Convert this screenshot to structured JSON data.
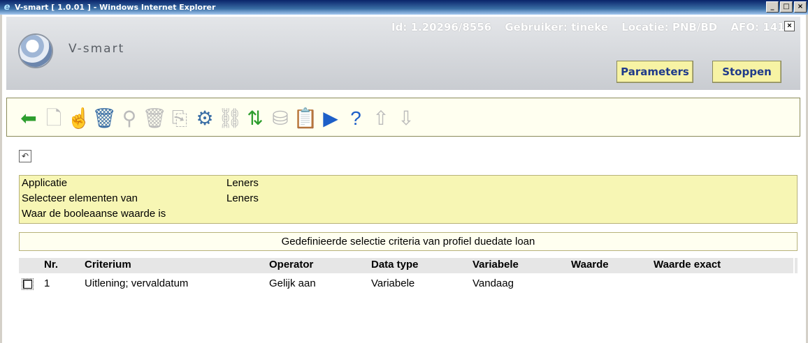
{
  "window": {
    "title": "V-smart [ 1.0.01 ] - Windows Internet Explorer",
    "controls": [
      "_",
      "□",
      "×"
    ]
  },
  "header": {
    "brand": "V-smart",
    "id_label": "Id: 1.20296/8556",
    "user_label": "Gebruiker: tineke",
    "location_label": "Locatie: PNB/BD",
    "afo_label": "AFO: 141",
    "close_glyph": "⊠",
    "parameters_button": "Parameters",
    "stop_button": "Stoppen"
  },
  "toolbar": {
    "icons": [
      {
        "name": "back-arrow-icon",
        "glyph": "⬅",
        "color": "#2e9e2e",
        "enabled": true
      },
      {
        "name": "new-document-icon",
        "glyph": "🗋",
        "color": "#bbbbbb",
        "enabled": false
      },
      {
        "name": "select-hand-icon",
        "glyph": "☝",
        "color": "#555555",
        "enabled": true
      },
      {
        "name": "delete-bin-icon",
        "glyph": "🗑",
        "color": "#3a6ea5",
        "enabled": true
      },
      {
        "name": "search-icon",
        "glyph": "⚲",
        "color": "#bbbbbb",
        "enabled": false
      },
      {
        "name": "delete-bin-disabled-icon",
        "glyph": "🗑",
        "color": "#bbbbbb",
        "enabled": false
      },
      {
        "name": "copy-icon",
        "glyph": "⎘",
        "color": "#bbbbbb",
        "enabled": false
      },
      {
        "name": "settings-form-icon",
        "glyph": "⚙",
        "color": "#3a6ea5",
        "enabled": true
      },
      {
        "name": "link-icon",
        "glyph": "⛓",
        "color": "#bbbbbb",
        "enabled": false
      },
      {
        "name": "sort-arrows-icon",
        "glyph": "⇅",
        "color": "#2e9e2e",
        "enabled": true
      },
      {
        "name": "database-icon",
        "glyph": "⛁",
        "color": "#bbbbbb",
        "enabled": false
      },
      {
        "name": "clipboard-icon",
        "glyph": "📋",
        "color": "#bbbbbb",
        "enabled": false
      },
      {
        "name": "play-icon",
        "glyph": "▶",
        "color": "#1d5fc8",
        "enabled": true
      },
      {
        "name": "help-icon",
        "glyph": "?",
        "color": "#1d5fc8",
        "enabled": true
      },
      {
        "name": "arrow-up-icon",
        "glyph": "⇧",
        "color": "#bbbbbb",
        "enabled": false
      },
      {
        "name": "arrow-down-icon",
        "glyph": "⇩",
        "color": "#bbbbbb",
        "enabled": false
      }
    ]
  },
  "undo_glyph": "↶",
  "details": {
    "rows": [
      {
        "label": "Applicatie",
        "value": "Leners"
      },
      {
        "label": "Selecteer elementen van",
        "value": "Leners"
      },
      {
        "label": "Waar de booleaanse waarde is",
        "value": ""
      }
    ]
  },
  "table": {
    "caption": "Gedefinieerde selectie criteria van profiel duedate loan",
    "columns": [
      "Nr.",
      "Criterium",
      "Operator",
      "Data type",
      "Variabele",
      "Waarde",
      "Waarde exact"
    ],
    "rows": [
      [
        "1",
        "Uitlening; vervaldatum",
        "Gelijk aan",
        "Variabele",
        "Vandaag",
        "",
        ""
      ]
    ]
  }
}
